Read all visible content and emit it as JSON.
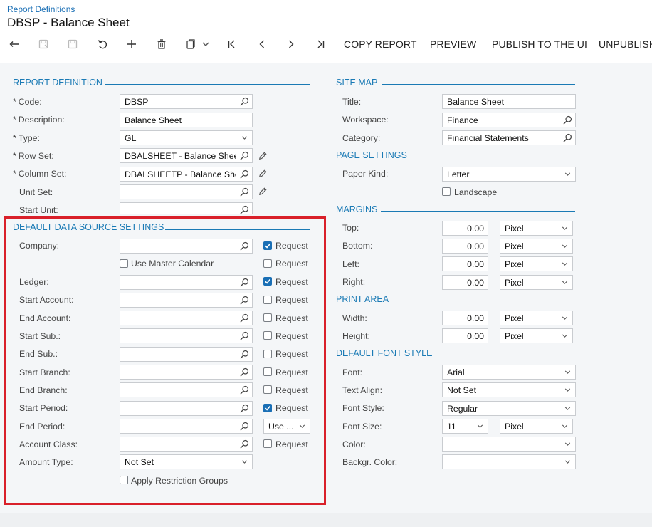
{
  "header": {
    "breadcrumb": "Report Definitions",
    "title": "DBSP - Balance Sheet"
  },
  "toolbar": {
    "icons": [
      "back-icon",
      "save-icon",
      "save-close-icon",
      "undo-icon",
      "add-icon",
      "delete-icon",
      "copy-paste-icon",
      "chevron-down-icon",
      "first-record-icon",
      "previous-icon",
      "next-icon",
      "last-record-icon"
    ],
    "copy_report": "COPY REPORT",
    "preview": "PREVIEW",
    "publish": "PUBLISH TO THE UI",
    "unpublish": "UNPUBLISH"
  },
  "report_definition": {
    "heading": "REPORT DEFINITION",
    "code": {
      "label": "Code:",
      "value": "DBSP",
      "required": "*"
    },
    "description": {
      "label": "Description:",
      "value": "Balance Sheet",
      "required": "*"
    },
    "type": {
      "label": "Type:",
      "value": "GL",
      "required": "*"
    },
    "row_set": {
      "label": "Row Set:",
      "value": "DBALSHEET - Balance Shee",
      "required": "*"
    },
    "column_set": {
      "label": "Column Set:",
      "value": "DBALSHEETP - Balance She",
      "required": "*"
    },
    "unit_set": {
      "label": "Unit Set:",
      "value": ""
    },
    "start_unit": {
      "label": "Start Unit:",
      "value": ""
    }
  },
  "data_source": {
    "heading": "DEFAULT DATA SOURCE SETTINGS",
    "request_label": "Request",
    "company": {
      "label": "Company:",
      "value": "",
      "request": true
    },
    "use_master_calendar": {
      "label": "Use Master Calendar",
      "checked": false,
      "request": false
    },
    "ledger": {
      "label": "Ledger:",
      "value": "",
      "request": true
    },
    "start_account": {
      "label": "Start Account:",
      "value": "",
      "request": false
    },
    "end_account": {
      "label": "End Account:",
      "value": "",
      "request": false
    },
    "start_sub": {
      "label": "Start Sub.:",
      "value": "",
      "request": false
    },
    "end_sub": {
      "label": "End Sub.:",
      "value": "",
      "request": false
    },
    "start_branch": {
      "label": "Start Branch:",
      "value": "",
      "request": false
    },
    "end_branch": {
      "label": "End Branch:",
      "value": "",
      "request": false
    },
    "start_period": {
      "label": "Start Period:",
      "value": "",
      "request": true
    },
    "end_period": {
      "label": "End Period:",
      "value": "",
      "option": "Use ..."
    },
    "account_class": {
      "label": "Account Class:",
      "value": "",
      "request": false
    },
    "amount_type": {
      "label": "Amount Type:",
      "value": "Not Set"
    },
    "apply_restriction": {
      "label": "Apply Restriction Groups",
      "checked": false
    }
  },
  "site_map": {
    "heading": "SITE MAP",
    "title": {
      "label": "Title:",
      "value": "Balance Sheet"
    },
    "workspace": {
      "label": "Workspace:",
      "value": "Finance"
    },
    "category": {
      "label": "Category:",
      "value": "Financial Statements"
    }
  },
  "page_settings": {
    "heading": "PAGE SETTINGS",
    "paper_kind": {
      "label": "Paper Kind:",
      "value": "Letter"
    },
    "landscape": {
      "label": "Landscape",
      "checked": false
    }
  },
  "margins": {
    "heading": "MARGINS",
    "top": {
      "label": "Top:",
      "value": "0.00",
      "unit": "Pixel"
    },
    "bottom": {
      "label": "Bottom:",
      "value": "0.00",
      "unit": "Pixel"
    },
    "left": {
      "label": "Left:",
      "value": "0.00",
      "unit": "Pixel"
    },
    "right": {
      "label": "Right:",
      "value": "0.00",
      "unit": "Pixel"
    }
  },
  "print_area": {
    "heading": "PRINT AREA",
    "width": {
      "label": "Width:",
      "value": "0.00",
      "unit": "Pixel"
    },
    "height": {
      "label": "Height:",
      "value": "0.00",
      "unit": "Pixel"
    }
  },
  "font_style": {
    "heading": "DEFAULT FONT STYLE",
    "font": {
      "label": "Font:",
      "value": "Arial"
    },
    "text_align": {
      "label": "Text Align:",
      "value": "Not Set"
    },
    "font_style": {
      "label": "Font Style:",
      "value": "Regular"
    },
    "font_size": {
      "label": "Font Size:",
      "value": "11",
      "unit": "Pixel"
    },
    "color": {
      "label": "Color:",
      "value": ""
    },
    "backgr_color": {
      "label": "Backgr. Color:",
      "value": ""
    }
  },
  "colors": {
    "accent": "#1a7ab5",
    "highlight": "#d9202a",
    "checkbox_on": "#1a6fb5"
  }
}
